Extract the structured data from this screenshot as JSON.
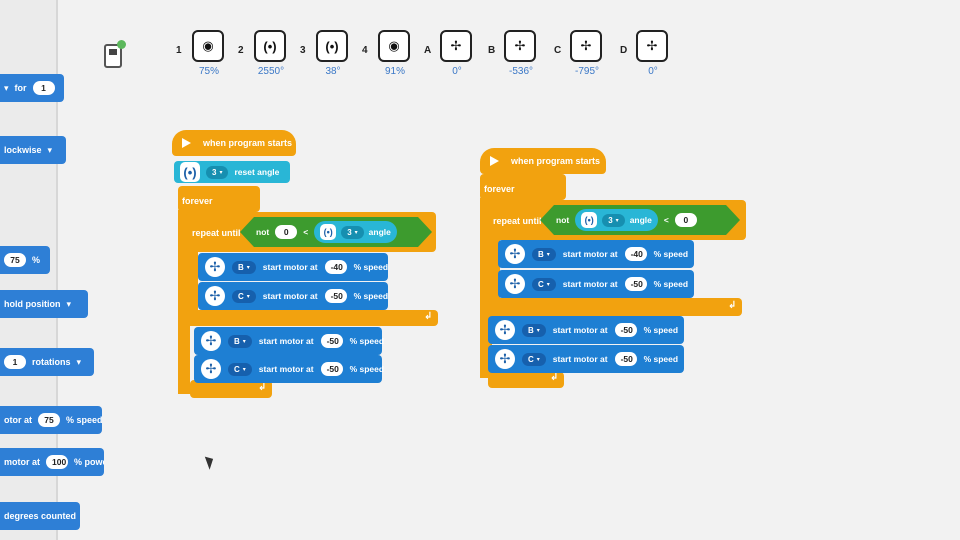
{
  "palette": {
    "items": [
      {
        "label": "for",
        "value": "1",
        "caret": "▾"
      },
      {
        "label": "lockwise",
        "caret": "▾"
      },
      {
        "value": "75",
        "unit": "%"
      },
      {
        "label": "hold position",
        "caret": "▾"
      },
      {
        "value": "1",
        "label": "rotations",
        "caret": "▾"
      },
      {
        "prefix": "otor at",
        "value": "75",
        "unit": "% speed"
      },
      {
        "prefix": "motor at",
        "value": "100",
        "unit": "% powe"
      },
      {
        "label": "degrees counted"
      }
    ]
  },
  "ports": [
    {
      "label": "1",
      "icon": "color-sensor-icon",
      "glyph": "◉",
      "value": "75%"
    },
    {
      "label": "2",
      "icon": "force-sensor-icon",
      "glyph": "(•)",
      "value": "2550°"
    },
    {
      "label": "3",
      "icon": "force-sensor-icon",
      "glyph": "(•)",
      "value": "38°"
    },
    {
      "label": "4",
      "icon": "color-sensor-icon",
      "glyph": "◉",
      "value": "91%"
    },
    {
      "label": "A",
      "icon": "motor-icon",
      "glyph": "✢",
      "value": "0°"
    },
    {
      "label": "B",
      "icon": "motor-icon",
      "glyph": "✢",
      "value": "-536°"
    },
    {
      "label": "C",
      "icon": "motor-icon",
      "glyph": "✢",
      "value": "-795°"
    },
    {
      "label": "D",
      "icon": "motor-icon",
      "glyph": "✢",
      "value": "0°"
    }
  ],
  "script1": {
    "hat": "when program starts",
    "reset": {
      "port": "3",
      "label": "reset angle",
      "caret": "▾"
    },
    "forever": "forever",
    "repeat": {
      "label": "repeat until",
      "not": "not",
      "lhs": "0",
      "op": "<",
      "port": "3",
      "sensor": "angle",
      "caret": "▾"
    },
    "inner": [
      {
        "port": "B",
        "label": "start motor at",
        "value": "-40",
        "unit": "% speed"
      },
      {
        "port": "C",
        "label": "start motor at",
        "value": "-50",
        "unit": "% speed"
      }
    ],
    "after": [
      {
        "port": "B",
        "label": "start motor at",
        "value": "-50",
        "unit": "% speed"
      },
      {
        "port": "C",
        "label": "start motor at",
        "value": "-50",
        "unit": "% speed"
      }
    ]
  },
  "script2": {
    "hat": "when program starts",
    "forever": "forever",
    "repeat": {
      "label": "repeat until",
      "not": "not",
      "port": "3",
      "sensor": "angle",
      "op": "<",
      "rhs": "0",
      "caret": "▾"
    },
    "inner": [
      {
        "port": "B",
        "label": "start motor at",
        "value": "-40",
        "unit": "% speed"
      },
      {
        "port": "C",
        "label": "start motor at",
        "value": "-50",
        "unit": "% speed"
      }
    ],
    "after": [
      {
        "port": "B",
        "label": "start motor at",
        "value": "-50",
        "unit": "% speed"
      },
      {
        "port": "C",
        "label": "start motor at",
        "value": "-50",
        "unit": "% speed"
      }
    ]
  },
  "glyphs": {
    "loop_arrow": "↲",
    "caret": "▾",
    "motor": "✢",
    "sensor": "(•)"
  }
}
